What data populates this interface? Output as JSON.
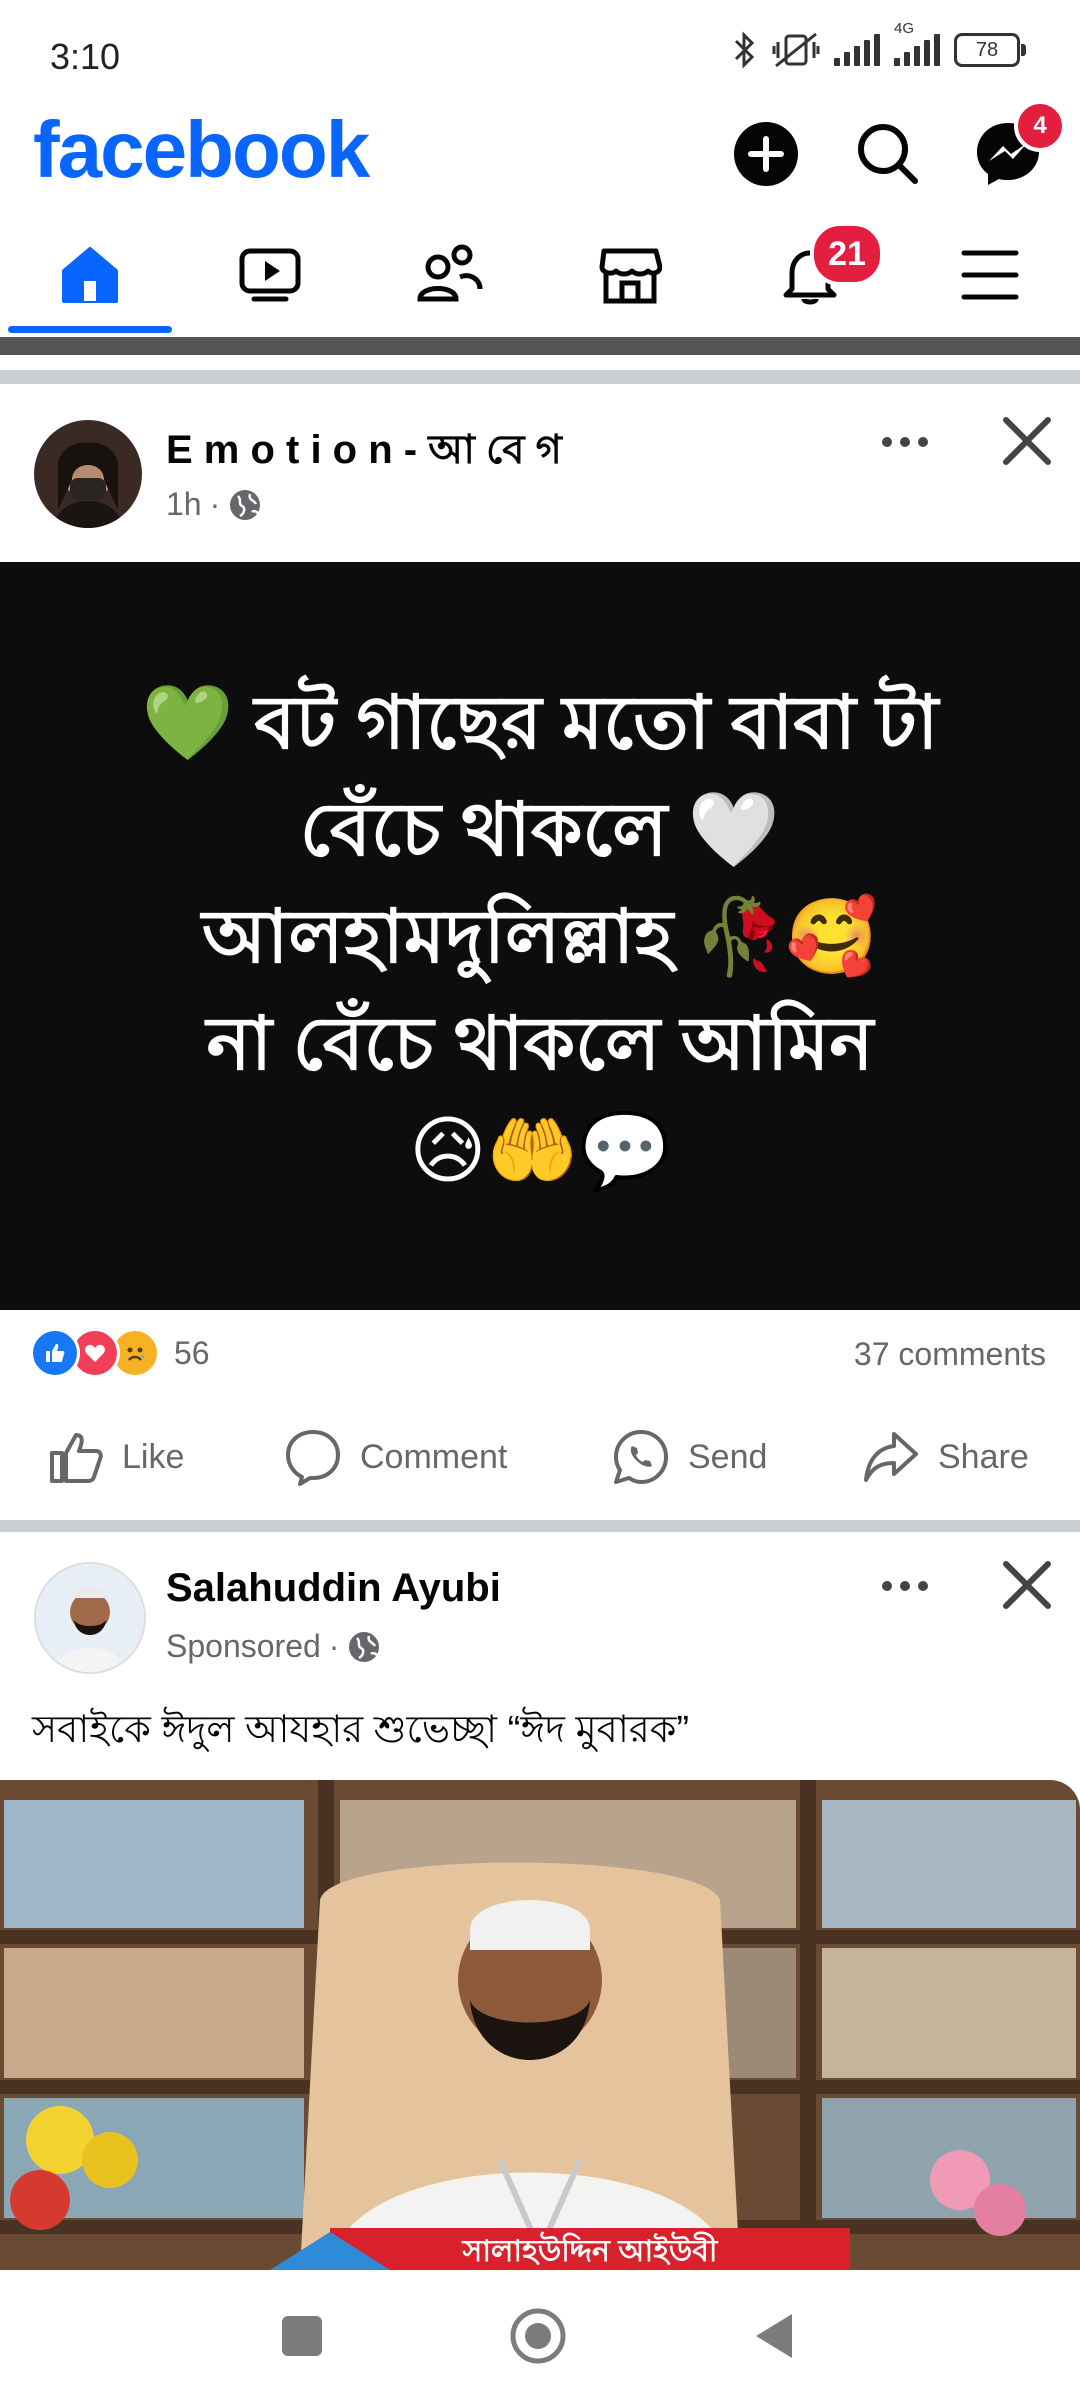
{
  "status_bar": {
    "time": "3:10",
    "network": "4G",
    "battery": "78",
    "icons": [
      "bluetooth-icon",
      "vibrate-off-icon",
      "signal-icon",
      "signal-4g-icon",
      "battery-icon"
    ]
  },
  "header": {
    "brand": "facebook",
    "brand_color": "#0866ff",
    "messenger_badge": "4"
  },
  "nav": {
    "tabs": [
      "home",
      "video",
      "friends",
      "marketplace",
      "notifications",
      "menu"
    ],
    "notifications_badge": "21",
    "active": "home"
  },
  "posts": [
    {
      "author": "E m o t i o n - আ বে গ",
      "time": "1h",
      "text": "💚 বট গাছের মতো বাবা টা\nবেঁচে থাকলে 🤍\nআলহামদুলিল্লাহ 🥀🥰\nনা বেঁচে থাকলে আমিন\n😥🤲💬",
      "reactions_count": "56",
      "comments": "37 comments",
      "actions": {
        "like": "Like",
        "comment": "Comment",
        "send": "Send",
        "share": "Share"
      }
    },
    {
      "author": "Salahuddin Ayubi",
      "time": "Sponsored",
      "caption": "সবাইকে ঈদুল আযহার শুভেচ্ছা “ঈদ মুবারক”",
      "banner_text": "সালাহউদ্দিন আইউবী"
    }
  ]
}
